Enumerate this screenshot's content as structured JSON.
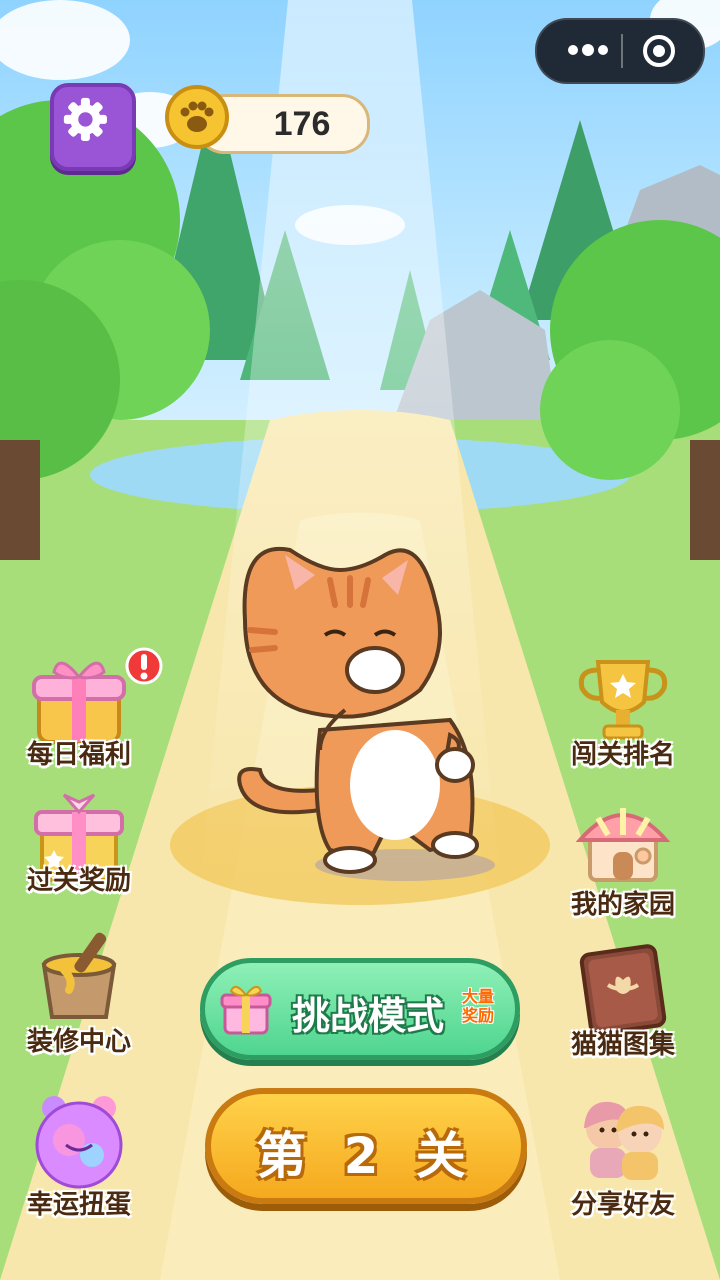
{
  "header": {
    "coins": "176"
  },
  "left_menu": [
    {
      "label": "每日福利",
      "icon": "gift-chest-icon",
      "has_alert": true
    },
    {
      "label": "过关奖励",
      "icon": "gift-box-icon"
    },
    {
      "label": "装修中心",
      "icon": "paint-bucket-icon"
    },
    {
      "label": "幸运扭蛋",
      "icon": "bear-ball-icon"
    }
  ],
  "right_menu": [
    {
      "label": "闯关排名",
      "icon": "trophy-icon"
    },
    {
      "label": "我的家园",
      "icon": "house-icon"
    },
    {
      "label": "猫猫图集",
      "icon": "album-book-icon"
    },
    {
      "label": "分享好友",
      "icon": "friends-icon"
    }
  ],
  "challenge": {
    "label": "挑战模式",
    "tag_line1": "大量",
    "tag_line2": "奖励"
  },
  "level": {
    "label": "第 2 关"
  },
  "colors": {
    "settings": "#9a55d6",
    "challenge": "#4fd58f",
    "level": "#f5a91e"
  }
}
